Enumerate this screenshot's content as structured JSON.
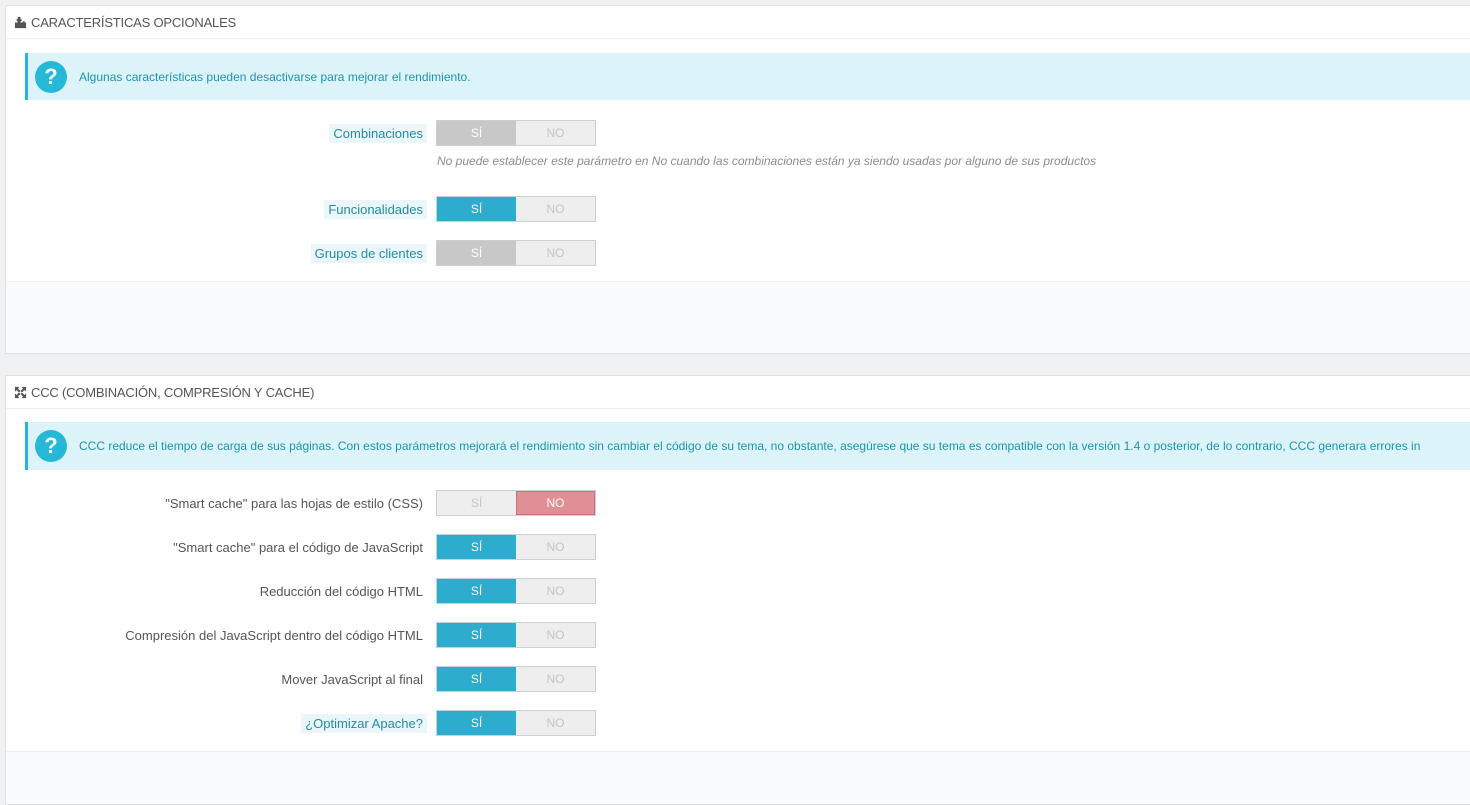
{
  "optional": {
    "title": "CARACTERÍSTICAS OPCIONALES",
    "icon": "puzzle-icon",
    "alert": "Algunas características pueden desactivarse para mejorar el rendimiento.",
    "hint": "No puede establecer este parámetro en No cuando las combinaciones están ya siendo usadas por alguno de sus productos",
    "rows": [
      {
        "label": "Combinaciones",
        "yes": "SÍ",
        "no": "NO",
        "value": "yes",
        "disabled": true
      },
      {
        "label": "Funcionalidades",
        "yes": "SÍ",
        "no": "NO",
        "value": "yes",
        "disabled": false
      },
      {
        "label": "Grupos de clientes",
        "yes": "SÍ",
        "no": "NO",
        "value": "yes",
        "disabled": true
      }
    ]
  },
  "ccc": {
    "title": "CCC (COMBINACIÓN, COMPRESIÓN Y CACHE)",
    "icon": "fullscreen-icon",
    "alert": "CCC reduce el tiempo de carga de sus páginas. Con estos parámetros mejorará el rendimiento sin cambiar el código de su tema, no obstante, asegúrese que su tema es compatible con la versión 1.4 o posterior, de lo contrario, CCC generara errores in",
    "rows": [
      {
        "label": "\"Smart cache\" para las hojas de estilo (CSS)",
        "yes": "SÍ",
        "no": "NO",
        "value": "no"
      },
      {
        "label": "\"Smart cache\" para el código de JavaScript",
        "yes": "SÍ",
        "no": "NO",
        "value": "yes"
      },
      {
        "label": "Reducción del código HTML",
        "yes": "SÍ",
        "no": "NO",
        "value": "yes"
      },
      {
        "label": "Compresión del JavaScript dentro del código HTML",
        "yes": "SÍ",
        "no": "NO",
        "value": "yes"
      },
      {
        "label": "Mover JavaScript al final",
        "yes": "SÍ",
        "no": "NO",
        "value": "yes"
      },
      {
        "label": "¿Optimizar Apache?",
        "yes": "SÍ",
        "no": "NO",
        "value": "yes"
      }
    ]
  },
  "colors": {
    "accent": "#25b9d7",
    "switch_on": "#2eacce",
    "switch_no": "#e08f95",
    "disabled": "#c8c8c8"
  }
}
